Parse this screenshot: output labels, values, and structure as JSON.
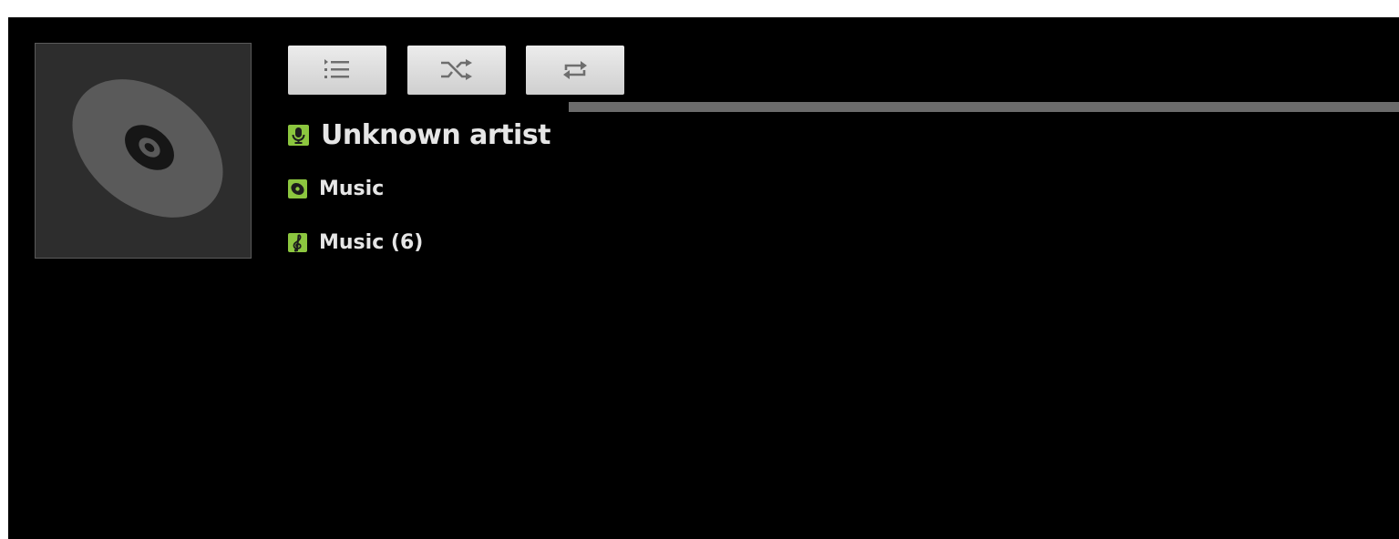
{
  "now_playing": {
    "artist": "Unknown artist",
    "album": "Music",
    "playlist": "Music (6)"
  },
  "icons": {
    "album_art": "cd-disc-icon",
    "queue": "playlist-queue-icon",
    "shuffle": "shuffle-icon",
    "repeat": "repeat-icon",
    "artist": "microphone-icon",
    "album": "disc-icon",
    "playlist": "treble-clef-icon"
  },
  "colors": {
    "background": "#000000",
    "accent_green": "#8cc63f",
    "button_face": "#dcdcdc",
    "progress_track": "#6b6b6b",
    "text": "#e6e6e6"
  }
}
